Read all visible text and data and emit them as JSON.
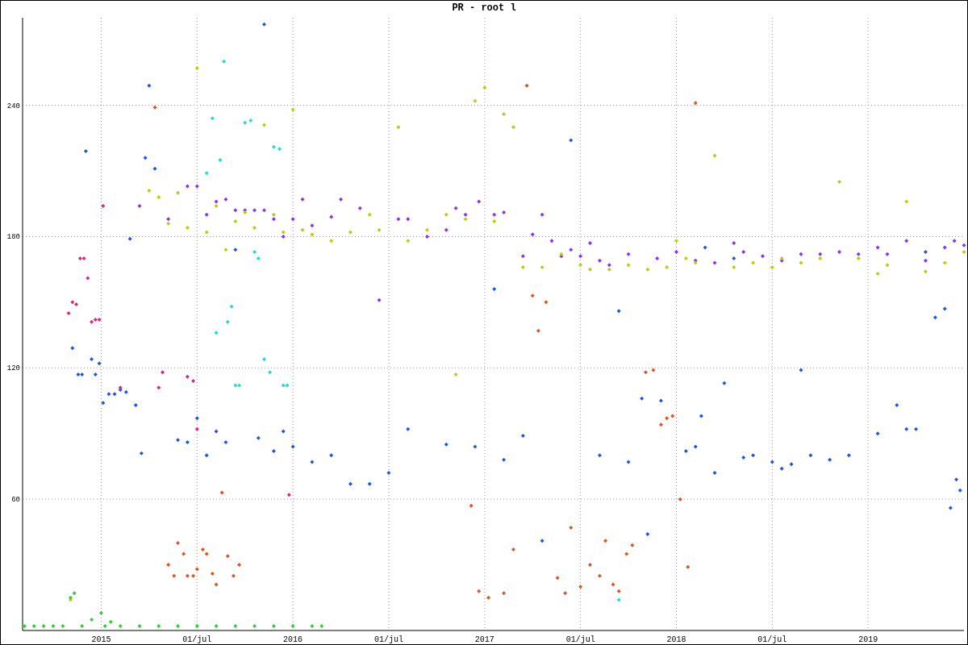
{
  "chart_data": {
    "type": "scatter",
    "grid": true,
    "title": "PR - root l",
    "xlim": [
      2014.59,
      2019.5
    ],
    "ylim": [
      0,
      280
    ],
    "xticks": [
      {
        "value": 2015,
        "label": "2015"
      },
      {
        "value": 2015.5,
        "label": "01/jul"
      },
      {
        "value": 2016,
        "label": "2016"
      },
      {
        "value": 2016.5,
        "label": "01/jul"
      },
      {
        "value": 2017,
        "label": "2017"
      },
      {
        "value": 2017.5,
        "label": "01/jul"
      },
      {
        "value": 2018,
        "label": "2018"
      },
      {
        "value": 2018.5,
        "label": "01/jul"
      },
      {
        "value": 2019,
        "label": "2019"
      }
    ],
    "yticks": [
      60,
      120,
      180,
      240
    ],
    "series": [
      {
        "color": "#2255dd",
        "x": [
          2014.85,
          2014.88,
          2014.9,
          2014.92,
          2014.95,
          2014.97,
          2014.99,
          2015.01,
          2015.04,
          2015.07,
          2015.1,
          2015.13,
          2015.15,
          2015.18,
          2015.21,
          2015.23,
          2015.25,
          2015.28,
          2015.4,
          2015.45,
          2015.5,
          2015.55,
          2015.6,
          2015.65,
          2015.7,
          2015.82,
          2015.85,
          2015.9,
          2015.95,
          2016.0,
          2016.1,
          2016.2,
          2016.3,
          2016.4,
          2016.5,
          2016.6,
          2016.8,
          2016.95,
          2017.05,
          2017.1,
          2017.2,
          2017.3,
          2017.45,
          2017.6,
          2017.7,
          2017.75,
          2017.85,
          2017.82,
          2017.92,
          2018.05,
          2018.1,
          2018.13,
          2018.15,
          2018.2,
          2018.25,
          2018.3,
          2018.35,
          2018.4,
          2018.5,
          2018.55,
          2018.6,
          2018.65,
          2018.7,
          2018.8,
          2018.9,
          2019.05,
          2019.15,
          2019.2,
          2019.25,
          2019.3,
          2019.35,
          2019.4,
          2019.43,
          2019.46,
          2019.48
        ],
        "values": [
          129,
          117,
          117,
          219,
          124,
          117,
          122,
          104,
          108,
          108,
          110,
          109,
          179,
          103,
          81,
          216,
          249,
          211,
          87,
          86,
          97,
          80,
          91,
          86,
          174,
          88,
          277,
          82,
          91,
          84,
          77,
          80,
          67,
          67,
          72,
          92,
          85,
          84,
          156,
          78,
          89,
          41,
          224,
          80,
          146,
          77,
          44,
          106,
          105,
          82,
          84,
          98,
          175,
          72,
          113,
          170,
          79,
          80,
          77,
          74,
          76,
          119,
          80,
          78,
          80,
          90,
          103,
          92,
          92,
          173,
          143,
          147,
          56,
          69,
          64
        ]
      },
      {
        "color": "#8833ee",
        "x": [
          2015.2,
          2015.35,
          2015.45,
          2015.5,
          2015.55,
          2015.6,
          2015.65,
          2015.7,
          2015.75,
          2015.8,
          2015.85,
          2015.9,
          2015.95,
          2016.0,
          2016.05,
          2016.1,
          2016.2,
          2016.25,
          2016.35,
          2016.45,
          2016.55,
          2016.6,
          2016.7,
          2016.8,
          2016.85,
          2016.9,
          2016.97,
          2017.05,
          2017.1,
          2017.2,
          2017.25,
          2017.3,
          2017.35,
          2017.4,
          2017.45,
          2017.5,
          2017.55,
          2017.6,
          2017.65,
          2017.75,
          2017.9,
          2018.0,
          2018.1,
          2018.2,
          2018.3,
          2018.35,
          2018.45,
          2018.55,
          2018.65,
          2018.75,
          2018.85,
          2018.95,
          2019.05,
          2019.1,
          2019.2,
          2019.3,
          2019.4,
          2019.45,
          2019.5
        ],
        "values": [
          194,
          188,
          203,
          203,
          190,
          196,
          197,
          192,
          192,
          192,
          192,
          188,
          180,
          188,
          197,
          185,
          189,
          197,
          193,
          151,
          188,
          188,
          180,
          183,
          193,
          190,
          196,
          190,
          191,
          171,
          181,
          190,
          178,
          171,
          174,
          171,
          177,
          169,
          167,
          172,
          170,
          173,
          169,
          168,
          177,
          173,
          171,
          169,
          172,
          172,
          173,
          172,
          175,
          172,
          178,
          169,
          175,
          178,
          176
        ]
      },
      {
        "color": "#bbcc11",
        "x": [
          2014.84,
          2015.25,
          2015.3,
          2015.35,
          2015.4,
          2015.45,
          2015.5,
          2015.55,
          2015.6,
          2015.65,
          2015.7,
          2015.75,
          2015.8,
          2015.85,
          2015.9,
          2015.95,
          2016.0,
          2016.05,
          2016.1,
          2016.2,
          2016.3,
          2016.4,
          2016.45,
          2016.55,
          2016.6,
          2016.7,
          2016.8,
          2016.85,
          2016.9,
          2016.95,
          2017.0,
          2017.05,
          2017.1,
          2017.15,
          2017.2,
          2017.3,
          2017.4,
          2017.5,
          2017.55,
          2017.65,
          2017.75,
          2017.85,
          2017.95,
          2018.0,
          2018.05,
          2018.1,
          2018.2,
          2018.3,
          2018.4,
          2018.5,
          2018.55,
          2018.65,
          2018.75,
          2018.85,
          2018.95,
          2019.05,
          2019.1,
          2019.2,
          2019.3,
          2019.4,
          2019.5
        ],
        "values": [
          14,
          201,
          198,
          186,
          200,
          184,
          257,
          182,
          194,
          174,
          187,
          191,
          184,
          231,
          190,
          182,
          238,
          183,
          181,
          178,
          182,
          190,
          183,
          230,
          178,
          183,
          190,
          117,
          188,
          242,
          248,
          187,
          236,
          230,
          166,
          166,
          172,
          167,
          165,
          165,
          167,
          165,
          166,
          178,
          170,
          168,
          217,
          166,
          168,
          166,
          170,
          168,
          170,
          205,
          170,
          163,
          167,
          196,
          164,
          168,
          173
        ]
      },
      {
        "color": "#dd2288",
        "x": [
          2014.83,
          2014.85,
          2014.87,
          2014.89,
          2014.91,
          2014.93,
          2014.95,
          2014.97,
          2014.99,
          2015.01,
          2015.1,
          2015.3,
          2015.32,
          2015.45,
          2015.48,
          2015.5,
          2015.98
        ],
        "values": [
          145,
          150,
          149,
          170,
          170,
          161,
          141,
          142,
          142,
          194,
          111,
          111,
          118,
          116,
          114,
          92,
          62
        ]
      },
      {
        "color": "#22ddcc",
        "x": [
          2015.55,
          2015.58,
          2015.6,
          2015.62,
          2015.64,
          2015.66,
          2015.68,
          2015.7,
          2015.72,
          2015.75,
          2015.78,
          2015.8,
          2015.82,
          2015.85,
          2015.88,
          2015.9,
          2015.93,
          2015.95,
          2015.97,
          2017.7
        ],
        "values": [
          209,
          234,
          136,
          215,
          260,
          141,
          148,
          112,
          112,
          232,
          233,
          173,
          170,
          124,
          118,
          221,
          220,
          112,
          112,
          14
        ]
      },
      {
        "color": "#dd5522",
        "x": [
          2015.28,
          2015.35,
          2015.38,
          2015.4,
          2015.43,
          2015.45,
          2015.48,
          2015.5,
          2015.53,
          2015.55,
          2015.58,
          2015.6,
          2015.63,
          2015.66,
          2015.69,
          2015.72,
          2016.93,
          2016.97,
          2017.02,
          2017.1,
          2017.15,
          2017.22,
          2017.25,
          2017.28,
          2017.32,
          2017.38,
          2017.42,
          2017.45,
          2017.5,
          2017.55,
          2017.6,
          2017.63,
          2017.67,
          2017.7,
          2017.74,
          2017.77,
          2017.84,
          2017.88,
          2017.92,
          2017.95,
          2017.98,
          2018.02,
          2018.06,
          2018.1
        ],
        "values": [
          239,
          30,
          25,
          40,
          35,
          25,
          25,
          28,
          37,
          35,
          26,
          21,
          63,
          34,
          25,
          30,
          57,
          18,
          15,
          17,
          37,
          249,
          153,
          137,
          150,
          24,
          17,
          47,
          20,
          30,
          25,
          41,
          21,
          18,
          35,
          39,
          118,
          119,
          94,
          97,
          98,
          60,
          29,
          241
        ]
      },
      {
        "color": "#33cc33",
        "x": [
          2014.6,
          2014.65,
          2014.7,
          2014.75,
          2014.8,
          2014.84,
          2014.86,
          2014.9,
          2014.95,
          2015.0,
          2015.02,
          2015.05,
          2015.1,
          2015.2,
          2015.3,
          2015.4,
          2015.5,
          2015.6,
          2015.7,
          2015.8,
          2015.9,
          2016.0,
          2016.1,
          2016.15
        ],
        "values": [
          2,
          2,
          2,
          2,
          2,
          15,
          17,
          2,
          5,
          8,
          2,
          4,
          2,
          2,
          2,
          2,
          2,
          2,
          2,
          2,
          2,
          2,
          2,
          2
        ]
      }
    ]
  }
}
